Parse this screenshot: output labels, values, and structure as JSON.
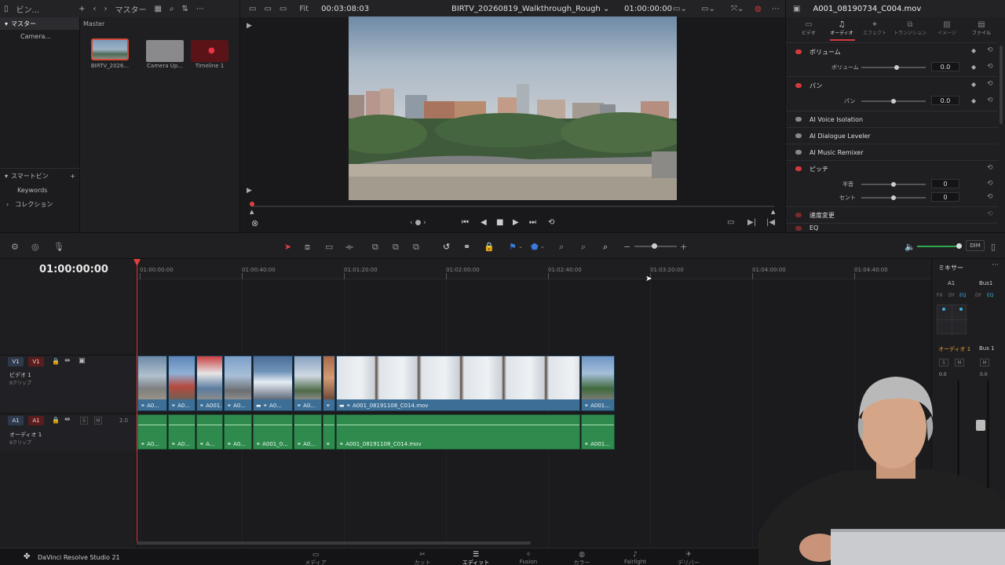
{
  "mediapool": {
    "tab_label": "ビン...",
    "bins": [
      "マスター",
      "Camera..."
    ],
    "smartbins_label": "スマートビン",
    "smartbins": [
      "Keywords",
      "コレクション"
    ],
    "master_label": "Master",
    "clips": [
      "BIRTV_2026...",
      "Camera Up...",
      "Timeline 1"
    ]
  },
  "topbar": {
    "master_menu": "マスター",
    "fit_label": "Fit",
    "source_timecode": "00:03:08:03",
    "timeline_name": "BIRTV_20260819_Walkthrough_Rough",
    "record_timecode": "01:00:00:00",
    "inspector_clip": "A001_08190734_C004.mov"
  },
  "inspector": {
    "tabs": [
      "ビデオ",
      "オーディオ",
      "エフェクト",
      "トランジション",
      "イメージ",
      "ファイル"
    ],
    "active_tab": 1,
    "volume_header": "ボリューム",
    "volume_label": "ボリューム",
    "volume_value": "0.0",
    "volume_level": 0.55,
    "pan_header": "パン",
    "pan_label": "パン",
    "pan_value": "0.0",
    "pan_level": 0.5,
    "ai_voice": "AI Voice Isolation",
    "ai_dialogue": "AI Dialogue Leveler",
    "ai_music": "AI Music Remixer",
    "pitch_header": "ピッチ",
    "semitone_label": "半音",
    "semitone_value": "0",
    "cent_label": "セント",
    "cent_value": "0",
    "speed_header": "速度変更",
    "eq_header": "EQ"
  },
  "timeline": {
    "timecode": "01:00:00:00",
    "ruler_marks": [
      "01:00:00:00",
      "01:00:40:00",
      "01:01:20:00",
      "01:02:00:00",
      "01:02:40:00",
      "01:03:20:00",
      "01:04:00:00",
      "01:04:40:00"
    ],
    "v1_label": "V1",
    "v1_name": "ビデオ 1",
    "v1_count": "9クリップ",
    "a1_label": "A1",
    "a1_name": "オーディオ 1",
    "a1_count": "9クリップ",
    "a1_level": "2.0",
    "solo": "S",
    "mute": "M",
    "video_clips": [
      "A0...",
      "A0...",
      "A001...",
      "A0...",
      "A0...",
      "A0...",
      "",
      "A001_08191108_C014.mov",
      "A001..."
    ],
    "audio_clips": [
      "A0...",
      "A0...",
      "A...",
      "A0...",
      "A001_0...",
      "A0...",
      "",
      "A001_08191108_C014.mov",
      "A001..."
    ]
  },
  "mixer": {
    "title": "ミキサー",
    "ch1": "A1",
    "ch2": "Bus1",
    "ch1_name": "オーディオ 1",
    "ch2_name": "Bus 1",
    "fx": "FX",
    "dy": "DY",
    "eq": "EQ",
    "s": "S",
    "m": "M",
    "meter_val": "0.0",
    "meter_val2": "0.0",
    "dim": "DIM"
  },
  "bottom": {
    "app_name": "DaVinci Resolve Studio 21",
    "pages": [
      "メディア",
      "カット",
      "エディット",
      "Fusion",
      "カラー",
      "Fairlight",
      "デリバー"
    ],
    "active_page": 2
  },
  "colors": {
    "accent_red": "#d23a3a",
    "video_clip": "#3d6f96",
    "audio_clip": "#2f8a4e",
    "playhead": "#e04040"
  }
}
